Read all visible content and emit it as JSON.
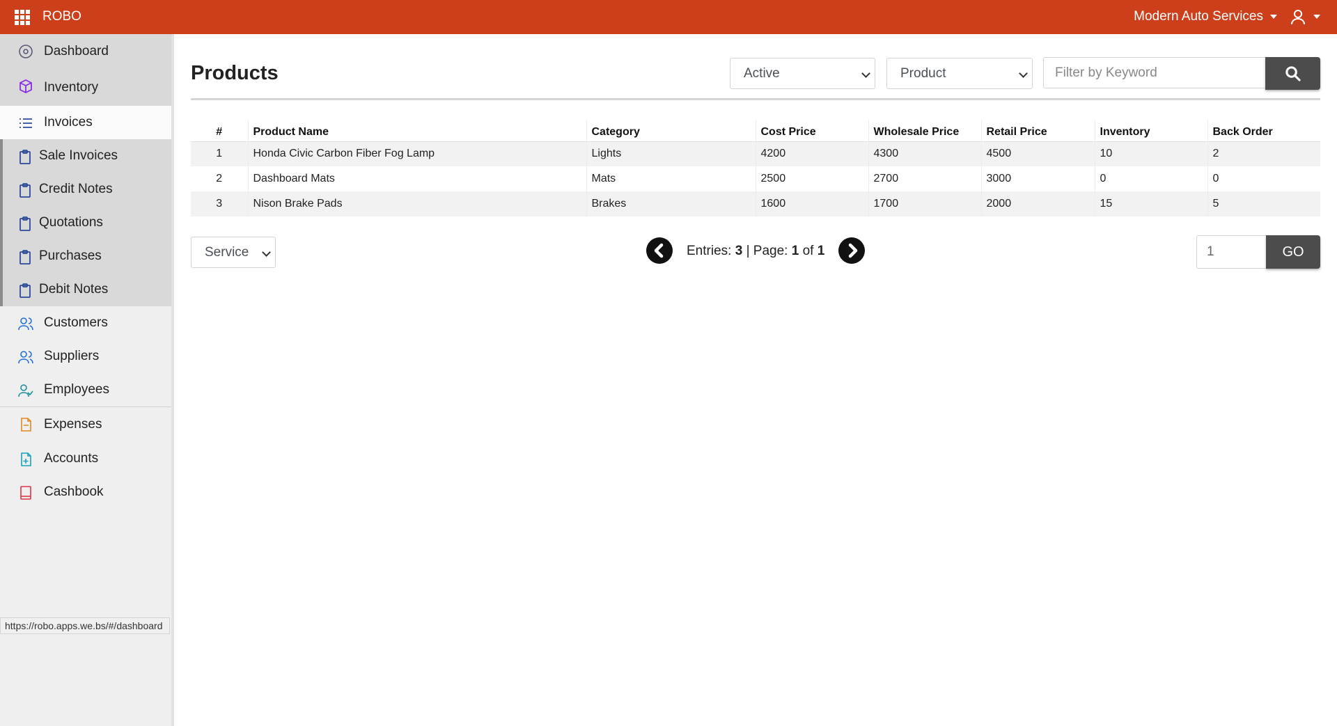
{
  "topbar": {
    "brand": "ROBO",
    "company": "Modern Auto Services",
    "colors": {
      "bar": "#cc3f1a"
    }
  },
  "sidebar": {
    "items": [
      {
        "label": "Dashboard",
        "icon": "dashboard-icon"
      },
      {
        "label": "Inventory",
        "icon": "box-icon"
      },
      {
        "label": "Invoices",
        "icon": "list-icon"
      },
      {
        "label": "Sale Invoices",
        "icon": "clipboard-icon"
      },
      {
        "label": "Credit Notes",
        "icon": "clipboard-icon"
      },
      {
        "label": "Quotations",
        "icon": "clipboard-icon"
      },
      {
        "label": "Purchases",
        "icon": "clipboard-icon"
      },
      {
        "label": "Debit Notes",
        "icon": "clipboard-icon"
      },
      {
        "label": "Customers",
        "icon": "people-icon"
      },
      {
        "label": "Suppliers",
        "icon": "people-icon"
      },
      {
        "label": "Employees",
        "icon": "person-check-icon"
      },
      {
        "label": "Expenses",
        "icon": "document-icon"
      },
      {
        "label": "Accounts",
        "icon": "document-plus-icon"
      },
      {
        "label": "Cashbook",
        "icon": "book-icon"
      }
    ]
  },
  "main": {
    "title": "Products",
    "filters": {
      "status": "Active",
      "type": "Product",
      "search_placeholder": "Filter by Keyword"
    },
    "table": {
      "columns": [
        "#",
        "Product Name",
        "Category",
        "Cost Price",
        "Wholesale Price",
        "Retail Price",
        "Inventory",
        "Back Order"
      ],
      "rows": [
        [
          "1",
          "Honda Civic Carbon Fiber Fog Lamp",
          "Lights",
          "4200",
          "4300",
          "4500",
          "10",
          "2"
        ],
        [
          "2",
          "Dashboard Mats",
          "Mats",
          "2500",
          "2700",
          "3000",
          "0",
          "0"
        ],
        [
          "3",
          "Nison Brake Pads",
          "Brakes",
          "1600",
          "1700",
          "2000",
          "15",
          "5"
        ]
      ]
    },
    "footer": {
      "type_select": "Service",
      "entries_label": "Entries:",
      "entries": "3",
      "page_label": "| Page:",
      "page": "1",
      "of_label": "of",
      "pages": "1",
      "page_input": "1",
      "go_label": "GO"
    }
  },
  "status_bar": {
    "url": "https://robo.apps.we.bs/#/dashboard"
  }
}
